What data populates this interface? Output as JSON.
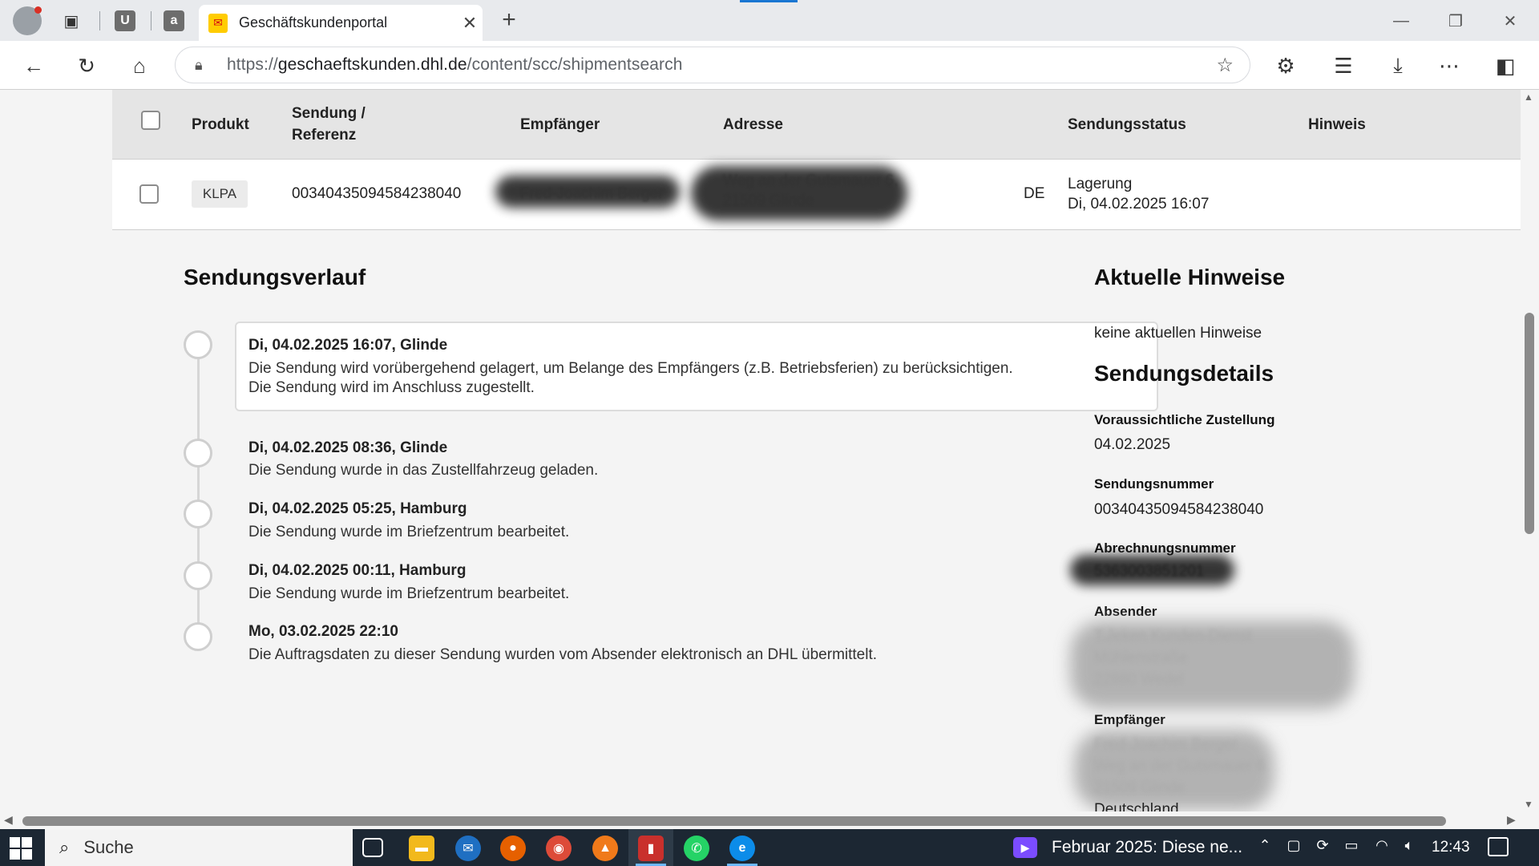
{
  "browser": {
    "tab_title": "Geschäftskundenportal",
    "url_scheme": "https://",
    "url_host": "geschaeftskunden.dhl.de",
    "url_path": "/content/scc/shipmentsearch"
  },
  "table": {
    "headers": {
      "product": "Produkt",
      "shipment_line1": "Sendung /",
      "shipment_line2": "Referenz",
      "recipient": "Empfänger",
      "address": "Adresse",
      "status": "Sendungsstatus",
      "note": "Hinweis"
    },
    "row": {
      "product": "KLPA",
      "shipment_number": "00340435094584238040",
      "recipient": "Fred-Joachim Berger",
      "address_line1": "Weg an der Gutsmauer 6,",
      "address_line2": "21509 Glinde",
      "country": "DE",
      "status_line1": "Lagerung",
      "status_line2": "Di, 04.02.2025 16:07"
    }
  },
  "history": {
    "heading": "Sendungsverlauf",
    "events": [
      {
        "title": "Di, 04.02.2025 16:07, Glinde",
        "text_line1": "Die Sendung wird vorübergehend gelagert, um Belange des Empfängers (z.B. Betriebsferien) zu berücksichtigen.",
        "text_line2": "Die Sendung wird im Anschluss zugestellt."
      },
      {
        "title": "Di, 04.02.2025 08:36, Glinde",
        "text_line1": "Die Sendung wurde in das Zustellfahrzeug geladen."
      },
      {
        "title": "Di, 04.02.2025 05:25, Hamburg",
        "text_line1": "Die Sendung wurde im Briefzentrum bearbeitet."
      },
      {
        "title": "Di, 04.02.2025 00:11, Hamburg",
        "text_line1": "Die Sendung wurde im Briefzentrum bearbeitet."
      },
      {
        "title": "Mo, 03.02.2025 22:10",
        "text_line1": "Die Auftragsdaten zu dieser Sendung wurden vom Absender elektronisch an DHL übermittelt."
      }
    ]
  },
  "sidebar": {
    "notes_heading": "Aktuelle Hinweise",
    "notes_text": "keine aktuellen Hinweise",
    "details_heading": "Sendungsdetails",
    "expected_label": "Voraussichtliche Zustellung",
    "expected_value": "04.02.2025",
    "number_label": "Sendungsnummer",
    "number_value": "00340435094584238040",
    "billing_label": "Abrechnungsnummer",
    "billing_value": "5363003851201",
    "sender_label": "Absender",
    "sender_line1": "T.Jeken Kunden-Dienst",
    "sender_line2": "Mühlenstraße",
    "sender_line3": "22880 Wedel",
    "recipient_label": "Empfänger",
    "recipient_line1": "Fred-Joachim Berger",
    "recipient_line2": "Weg an der Gutsmauer 6",
    "recipient_line3": "21509 Glinde",
    "recipient_line4": "Deutschland"
  },
  "taskbar": {
    "search_placeholder": "Suche",
    "notification": "Februar 2025: Diese ne...",
    "time": "12:43"
  },
  "colors": {
    "dhl_yellow": "#ffcc00",
    "dhl_red": "#d40511",
    "table_header_bg": "#e5e5e5",
    "taskbar_bg": "#1c2733"
  }
}
